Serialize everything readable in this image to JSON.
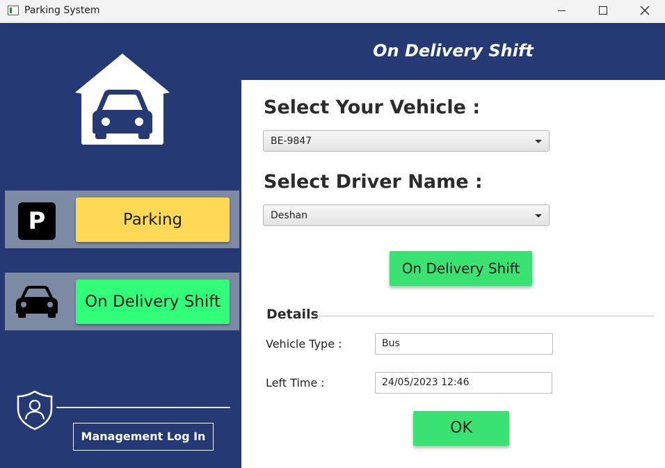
{
  "window": {
    "title": "Parking System"
  },
  "sidebar": {
    "nav": [
      {
        "label": "Parking",
        "color": "#ffd955"
      },
      {
        "label": "On Delivery Shift",
        "color": "#31ff7a"
      }
    ],
    "parking_icon_letter": "P",
    "management_login_label": "Management Log In",
    "background": "#253a74"
  },
  "header": {
    "title": "On Delivery Shift"
  },
  "main": {
    "select_vehicle_label": "Select Your Vehicle :",
    "vehicle_value": "BE-9847",
    "select_driver_label": "Select Driver Name :",
    "driver_value": "Deshan",
    "on_delivery_button": "On Delivery Shift",
    "details_title": "Details",
    "vehicle_type_label": "Vehicle Type :",
    "vehicle_type_value": "Bus",
    "left_time_label": "Left Time :",
    "left_time_value": "24/05/2023 12:46",
    "ok_button": "OK",
    "button_color": "#3ae271"
  },
  "icons": [
    "app-icon",
    "garage-car-icon",
    "parking-icon",
    "car-icon",
    "shield-user-icon",
    "chevron-down-icon",
    "minimize-icon",
    "maximize-icon",
    "close-icon"
  ]
}
